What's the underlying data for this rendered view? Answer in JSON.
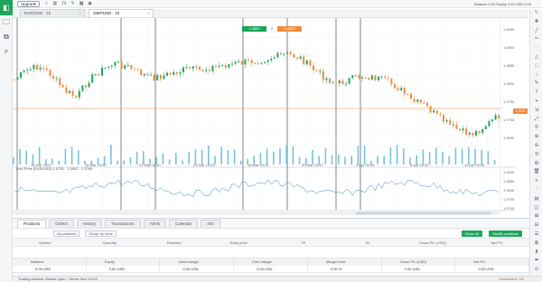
{
  "app": {
    "upgrade_button": "Upgrade",
    "account_info": "Balance 0.00  Equity 0.00  USD 0.00"
  },
  "chart_tabs": [
    {
      "label": "EUR/USD · 1h",
      "active": false
    },
    {
      "label": "GBP/USD · 1h",
      "active": true
    }
  ],
  "ticket": {
    "sell": "1.0850",
    "buy": "1.0852",
    "spread": "2"
  },
  "current_price": "1.0791",
  "x_labels": [
    "14 Mar 2023",
    "16 Mar 15:00",
    "21 Mar 09:00",
    "23 Mar 15:00",
    "28 Mar 09:00",
    "30 Mar 15:00",
    "4 Apr 09:00",
    "6 Apr 15:00",
    "11 Apr 09:00"
  ],
  "y_labels": [
    "1.0950",
    "1.0900",
    "1.0850",
    "1.0800",
    "1.0750",
    "1.0700",
    "1.0650"
  ],
  "indicator": {
    "legend": "Line Price (EUR/USD) 1.0791 · 1.0842 · 1.0789",
    "y_labels": [
      "1.0900",
      "1.0850",
      "1.0800",
      "1.0750",
      "1.0700"
    ]
  },
  "panel": {
    "tabs": [
      {
        "label": "Positions",
        "active": true
      },
      {
        "label": "Orders",
        "active": false
      },
      {
        "label": "History",
        "active": false
      },
      {
        "label": "Transactions",
        "active": false
      },
      {
        "label": "Alerts",
        "active": false
      },
      {
        "label": "Calendar",
        "active": false
      },
      {
        "label": "Info",
        "active": false
      }
    ],
    "filter_account": "All positions",
    "filter_group": "Group by none",
    "close_button": "Close all",
    "modify_button": "Modify positions",
    "columns": [
      "Symbol",
      "Quantity",
      "Direction",
      "Entry price",
      "TP",
      "SL",
      "Gross P/L (USD)",
      "Net P/L"
    ],
    "summary_headers": [
      "Balance",
      "Equity",
      "Used margin",
      "Free margin",
      "Margin level",
      "Gross P/L (USD)",
      "Net P/L"
    ],
    "summary_values": [
      "0.00 USD",
      "0.00 USD",
      "0.00 USD",
      "0.00 USD",
      "0.00 %",
      "0.00 USD",
      "0.00 USD"
    ]
  },
  "status": {
    "left": "Trading session: Market open  ·  Server time 13:45",
    "right": "Connection: OK"
  },
  "colors": {
    "bull": "#1fa55c",
    "bear": "#f08a3c",
    "volume": "#5fb8d3",
    "line": "#3a7fc0"
  }
}
